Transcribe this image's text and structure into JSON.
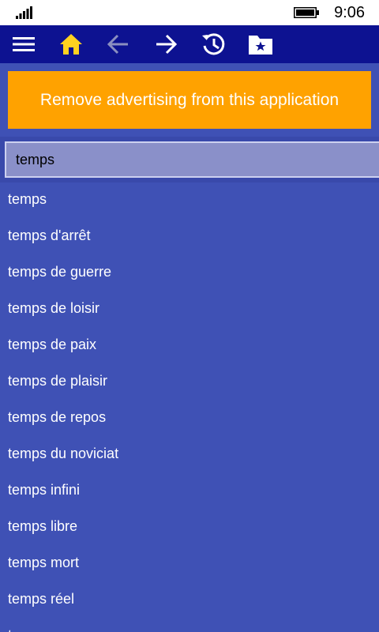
{
  "status_bar": {
    "time": "9:06",
    "icons": [
      "signal-icon",
      "battery-icon"
    ]
  },
  "app_bar": {
    "buttons": [
      {
        "name": "menu",
        "icon": "hamburger-menu-icon"
      },
      {
        "name": "home",
        "icon": "home-icon",
        "color": "#ffd21f"
      },
      {
        "name": "back",
        "icon": "arrow-left-icon",
        "color": "#8b8fc0"
      },
      {
        "name": "forward",
        "icon": "arrow-right-icon",
        "color": "#ffffff"
      },
      {
        "name": "history",
        "icon": "history-icon",
        "color": "#ffffff"
      },
      {
        "name": "favorites",
        "icon": "folder-star-icon",
        "color": "#ffffff"
      }
    ]
  },
  "ad": {
    "label": "Remove advertising from this application"
  },
  "search": {
    "value": "temps"
  },
  "results": [
    "temps",
    "temps d'arrêt",
    "temps de guerre",
    "temps de loisir",
    "temps de paix",
    "temps de plaisir",
    "temps de repos",
    "temps du noviciat",
    "temps infini",
    "temps libre",
    "temps mort",
    "temps réel",
    "temps..."
  ],
  "colors": {
    "status_bar_bg": "#ffffff",
    "app_bar_bg": "#0d1291",
    "content_bg": "#3f51b5",
    "ad_bg": "#ffa200",
    "search_bg": "#8a90c9",
    "home_icon": "#ffd21f"
  }
}
